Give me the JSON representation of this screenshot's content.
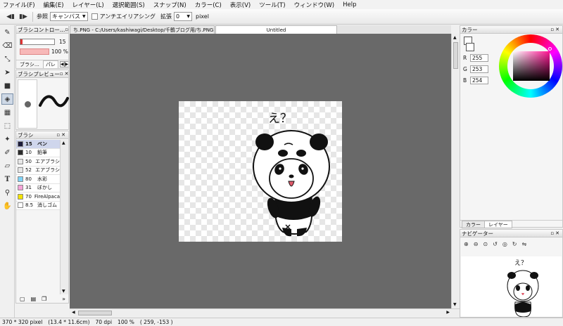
{
  "menu": [
    "ファイル(F)",
    "編集(E)",
    "レイヤー(L)",
    "選択範囲(S)",
    "スナップ(N)",
    "カラー(C)",
    "表示(V)",
    "ツール(T)",
    "ウィンドウ(W)",
    "Help"
  ],
  "toolbar": {
    "ref_label": "参照",
    "ref_value": "キャンバス",
    "antialias_label": "アンチエイリアシング",
    "expand_label": "拡張",
    "expand_value": "0",
    "unit": "pixel"
  },
  "brush_control": {
    "title": "ブラシコントロー…",
    "size": "15",
    "opacity": "100 %",
    "tab1": "ブラシ…",
    "tab2": "パレ"
  },
  "brush_preview": {
    "title": "ブラシプレビュー"
  },
  "brush_list": {
    "title": "ブラシ",
    "items": [
      {
        "size": "15",
        "name": "ペン",
        "color": "#1b1b3a"
      },
      {
        "size": "10",
        "name": "鉛筆",
        "color": "#2b2b2b"
      },
      {
        "size": "50",
        "name": "エアブラシ",
        "color": "#e6e6e6"
      },
      {
        "size": "52",
        "name": "エアブラシ",
        "color": "#e6e6e6"
      },
      {
        "size": "80",
        "name": "水彩",
        "color": "#7fd3f7"
      },
      {
        "size": "31",
        "name": "ぼかし",
        "color": "#f4a3d8"
      },
      {
        "size": "70",
        "name": "FireAlpaca",
        "color": "#f2e200"
      },
      {
        "size": "8.5",
        "name": "消しゴム",
        "color": "#ffffff"
      }
    ]
  },
  "doc_tabs": [
    "ち.PNG - C:/Users/kashiwagi/Desktop/千鶴ブログ用/ち.PNG",
    "Untitled"
  ],
  "color_panel": {
    "title": "カラー",
    "r_label": "R",
    "r": "255",
    "g_label": "G",
    "g": "253",
    "b_label": "B",
    "b": "254",
    "tab_color": "カラー",
    "tab_layer": "レイヤー"
  },
  "navigator": {
    "title": "ナビゲーター"
  },
  "canvas_text": "え？",
  "status": {
    "size": "370 * 320 pixel",
    "cm": "(13.4 * 11.6cm)",
    "dpi": "70 dpi",
    "zoom": "100 %",
    "coords": "( 259, -153 )"
  }
}
